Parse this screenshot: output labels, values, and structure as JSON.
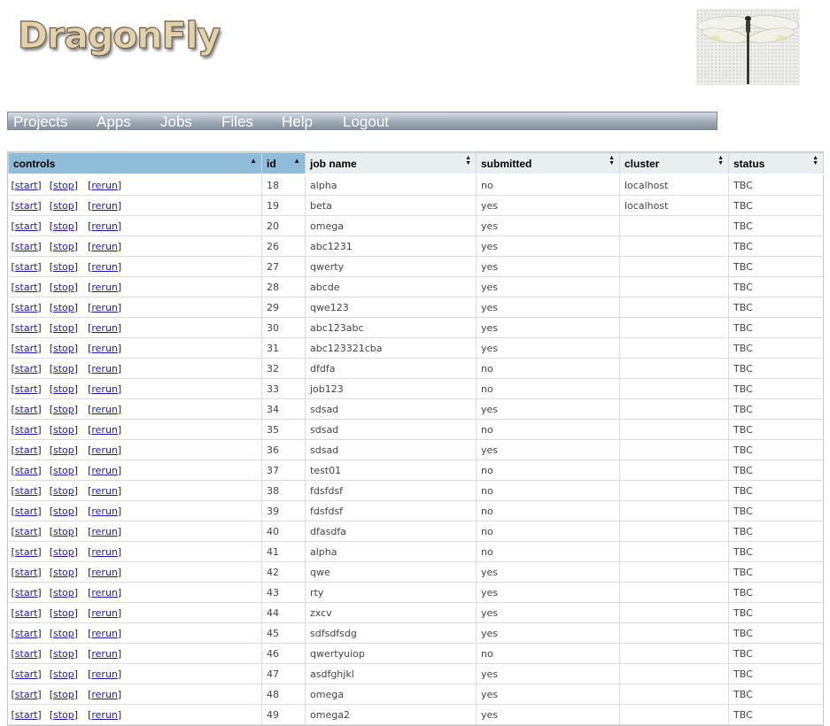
{
  "brand": {
    "logo_text": "DragonFly",
    "image": "dragonfly-photo"
  },
  "nav": {
    "items": [
      "Projects",
      "Apps",
      "Jobs",
      "Files",
      "Help",
      "Logout"
    ]
  },
  "table": {
    "columns": [
      {
        "label": "controls",
        "sort": "ascending"
      },
      {
        "label": "id",
        "sort": "ascending"
      },
      {
        "label": "job name",
        "sort": "both"
      },
      {
        "label": "submitted",
        "sort": "both"
      },
      {
        "label": "cluster",
        "sort": "both"
      },
      {
        "label": "status",
        "sort": "both"
      }
    ],
    "controls": {
      "start": "start",
      "stop": "stop",
      "rerun": "rerun",
      "open": "[",
      "close": "]"
    },
    "rows": [
      {
        "id": "18",
        "name": "alpha",
        "submitted": "no",
        "cluster": "localhost",
        "status": "TBC"
      },
      {
        "id": "19",
        "name": "beta",
        "submitted": "yes",
        "cluster": "localhost",
        "status": "TBC"
      },
      {
        "id": "20",
        "name": "omega",
        "submitted": "yes",
        "cluster": "",
        "status": "TBC"
      },
      {
        "id": "26",
        "name": "abc1231",
        "submitted": "yes",
        "cluster": "",
        "status": "TBC"
      },
      {
        "id": "27",
        "name": "qwerty",
        "submitted": "yes",
        "cluster": "",
        "status": "TBC"
      },
      {
        "id": "28",
        "name": "abcde",
        "submitted": "yes",
        "cluster": "",
        "status": "TBC"
      },
      {
        "id": "29",
        "name": "qwe123",
        "submitted": "yes",
        "cluster": "",
        "status": "TBC"
      },
      {
        "id": "30",
        "name": "abc123abc",
        "submitted": "yes",
        "cluster": "",
        "status": "TBC"
      },
      {
        "id": "31",
        "name": "abc123321cba",
        "submitted": "yes",
        "cluster": "",
        "status": "TBC"
      },
      {
        "id": "32",
        "name": "dfdfa",
        "submitted": "no",
        "cluster": "",
        "status": "TBC"
      },
      {
        "id": "33",
        "name": "job123",
        "submitted": "no",
        "cluster": "",
        "status": "TBC"
      },
      {
        "id": "34",
        "name": "sdsad",
        "submitted": "yes",
        "cluster": "",
        "status": "TBC"
      },
      {
        "id": "35",
        "name": "sdsad",
        "submitted": "no",
        "cluster": "",
        "status": "TBC"
      },
      {
        "id": "36",
        "name": "sdsad",
        "submitted": "yes",
        "cluster": "",
        "status": "TBC"
      },
      {
        "id": "37",
        "name": "test01",
        "submitted": "no",
        "cluster": "",
        "status": "TBC"
      },
      {
        "id": "38",
        "name": "fdsfdsf",
        "submitted": "no",
        "cluster": "",
        "status": "TBC"
      },
      {
        "id": "39",
        "name": "fdsfdsf",
        "submitted": "no",
        "cluster": "",
        "status": "TBC"
      },
      {
        "id": "40",
        "name": "dfasdfa",
        "submitted": "no",
        "cluster": "",
        "status": "TBC"
      },
      {
        "id": "41",
        "name": "alpha",
        "submitted": "no",
        "cluster": "",
        "status": "TBC"
      },
      {
        "id": "42",
        "name": "qwe",
        "submitted": "yes",
        "cluster": "",
        "status": "TBC"
      },
      {
        "id": "43",
        "name": "rty",
        "submitted": "yes",
        "cluster": "",
        "status": "TBC"
      },
      {
        "id": "44",
        "name": "zxcv",
        "submitted": "yes",
        "cluster": "",
        "status": "TBC"
      },
      {
        "id": "45",
        "name": "sdfsdfsdg",
        "submitted": "yes",
        "cluster": "",
        "status": "TBC"
      },
      {
        "id": "46",
        "name": "qwertyuiop",
        "submitted": "no",
        "cluster": "",
        "status": "TBC"
      },
      {
        "id": "47",
        "name": "asdfghjkl",
        "submitted": "yes",
        "cluster": "",
        "status": "TBC"
      },
      {
        "id": "48",
        "name": "omega",
        "submitted": "yes",
        "cluster": "",
        "status": "TBC"
      },
      {
        "id": "49",
        "name": "omega2",
        "submitted": "yes",
        "cluster": "",
        "status": "TBC"
      }
    ]
  },
  "colors": {
    "active_header": "#8fbcd9",
    "header": "#e9eef0",
    "link": "#1a1aa8",
    "navbar": "#a0aab5"
  }
}
